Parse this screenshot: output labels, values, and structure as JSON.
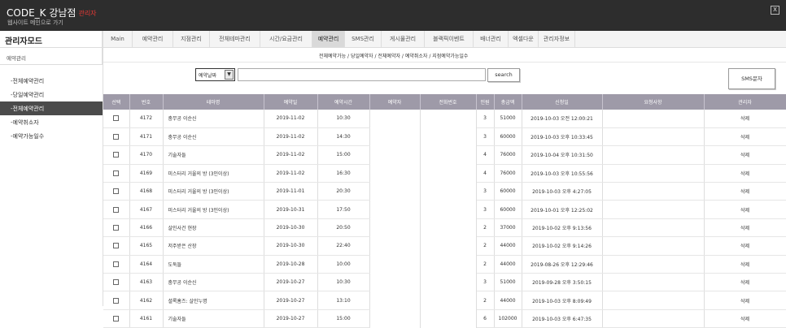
{
  "header": {
    "title": "CODE_K 강남점",
    "role": "관리자",
    "back_link": "웹사이트 메인으로 가기",
    "close_label": "X"
  },
  "sidebar": {
    "title": "관리자모드",
    "section": "예약관리",
    "items": [
      {
        "label": "-전체예약관리",
        "active": false
      },
      {
        "label": "-당일예약관리",
        "active": false
      },
      {
        "label": "-전체예약관리",
        "active": true
      },
      {
        "label": "-예약취소자",
        "active": false
      },
      {
        "label": "-예약가능일수",
        "active": false
      }
    ]
  },
  "nav": {
    "tabs": [
      {
        "label": "Main",
        "active": false
      },
      {
        "label": "예약관리",
        "active": false
      },
      {
        "label": "지점관리",
        "active": false
      },
      {
        "label": "전체테마관리",
        "active": false
      },
      {
        "label": "시간/요금관리",
        "active": false
      },
      {
        "label": "예약관리",
        "active": true
      },
      {
        "label": "SMS관리",
        "active": false
      },
      {
        "label": "게시물관리",
        "active": false
      },
      {
        "label": "블랙픽이벤트",
        "active": false
      },
      {
        "label": "배너관리",
        "active": false
      },
      {
        "label": "엑셀다운",
        "active": false
      },
      {
        "label": "관리자정보",
        "active": false
      }
    ]
  },
  "breadcrumb": "전체예약가능 / 당일예약자 / 전체예약자 / 예약취소자 / 지점예약가능일수",
  "search": {
    "select_value": "예약날짜",
    "input_value": "",
    "button_label": "search"
  },
  "sms_button_label": "SMS문자",
  "table": {
    "headers": [
      "선택",
      "번호",
      "테마명",
      "예약일",
      "예약시간",
      "예약자",
      "전화번호",
      "인원",
      "총금액",
      "신청일",
      "요청사항",
      "관리자"
    ],
    "rows": [
      {
        "no": "4172",
        "theme": "충무공 이순신",
        "date": "2019-11-02",
        "time": "10:30",
        "people": "3",
        "amount": "51000",
        "applied": "2019-10-03 오전 12:00:21",
        "action": "삭제"
      },
      {
        "no": "4171",
        "theme": "충무공 이순신",
        "date": "2019-11-02",
        "time": "14:30",
        "people": "3",
        "amount": "60000",
        "applied": "2019-10-03 오후 10:33:45",
        "action": "삭제"
      },
      {
        "no": "4170",
        "theme": "기술자들",
        "date": "2019-11-02",
        "time": "15:00",
        "people": "4",
        "amount": "76000",
        "applied": "2019-10-04 오후 10:31:50",
        "action": "삭제"
      },
      {
        "no": "4169",
        "theme": "미스터리 거울의 방 (3인이상)",
        "date": "2019-11-02",
        "time": "16:30",
        "people": "4",
        "amount": "76000",
        "applied": "2019-10-03 오후 10:55:56",
        "action": "삭제"
      },
      {
        "no": "4168",
        "theme": "미스터리 거울의 방 (3인이상)",
        "date": "2019-11-01",
        "time": "20:30",
        "people": "3",
        "amount": "60000",
        "applied": "2019-10-03 오후 4:27:05",
        "action": "삭제"
      },
      {
        "no": "4167",
        "theme": "미스터리 거울의 방 (3인이상)",
        "date": "2019-10-31",
        "time": "17:50",
        "people": "3",
        "amount": "60000",
        "applied": "2019-10-01 오후 12:25:02",
        "action": "삭제"
      },
      {
        "no": "4166",
        "theme": "살인사건 현장",
        "date": "2019-10-30",
        "time": "20:50",
        "people": "2",
        "amount": "37000",
        "applied": "2019-10-02 오후 9:13:56",
        "action": "삭제"
      },
      {
        "no": "4165",
        "theme": "저주받은 산장",
        "date": "2019-10-30",
        "time": "22:40",
        "people": "2",
        "amount": "44000",
        "applied": "2019-10-02 오후 9:14:26",
        "action": "삭제"
      },
      {
        "no": "4164",
        "theme": "도둑들",
        "date": "2019-10-28",
        "time": "10:00",
        "people": "2",
        "amount": "44000",
        "applied": "2019-08-26 오후 12:29:46",
        "action": "삭제"
      },
      {
        "no": "4163",
        "theme": "충무공 이순신",
        "date": "2019-10-27",
        "time": "10:30",
        "people": "3",
        "amount": "51000",
        "applied": "2019-09-28 오후 3:50:15",
        "action": "삭제"
      },
      {
        "no": "4162",
        "theme": "셜록홈즈: 살인누명",
        "date": "2019-10-27",
        "time": "13:10",
        "people": "2",
        "amount": "44000",
        "applied": "2019-10-03 오후 8:09:49",
        "action": "삭제"
      },
      {
        "no": "4161",
        "theme": "기술자들",
        "date": "2019-10-27",
        "time": "15:00",
        "people": "6",
        "amount": "102000",
        "applied": "2019-10-03 오후 6:47:35",
        "action": "삭제"
      }
    ]
  }
}
